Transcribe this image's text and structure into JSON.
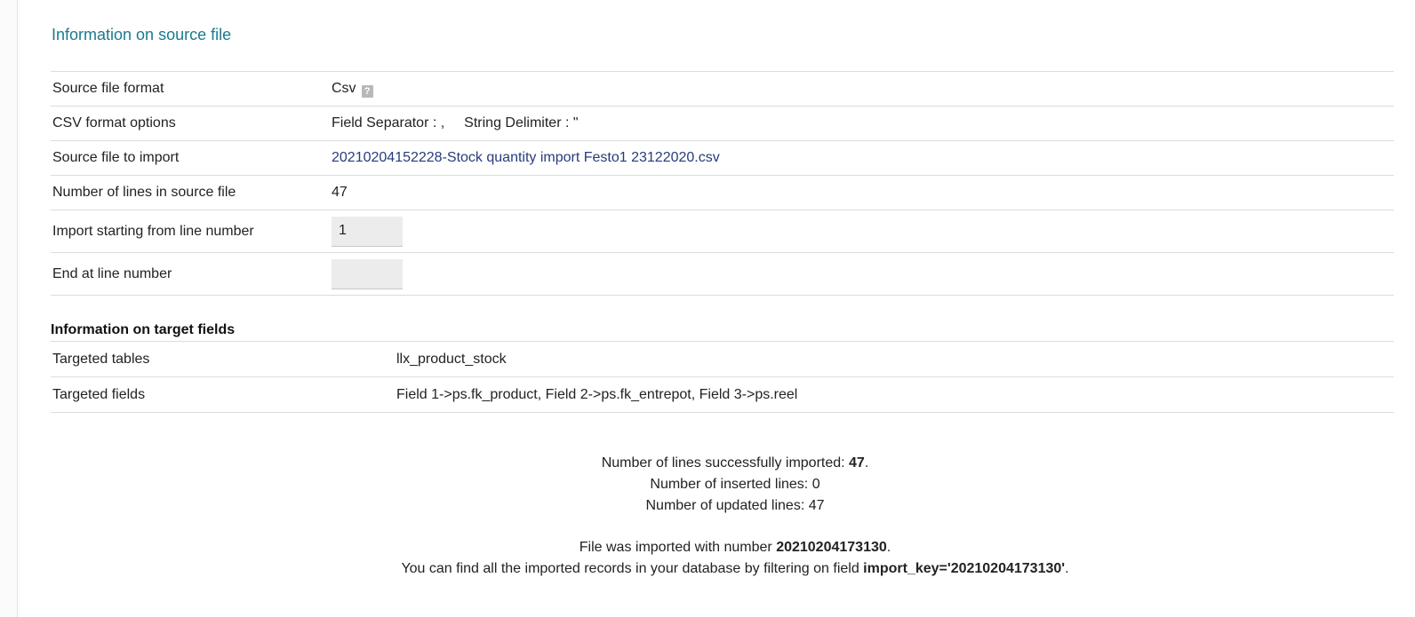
{
  "section_title": "Information on source file",
  "source_info": {
    "format_label": "Source file format",
    "format_value": "Csv",
    "help_icon": "question-mark",
    "csv_options_label": "CSV format options",
    "field_separator": "Field Separator : ,",
    "string_delimiter": "String Delimiter : \"",
    "file_label": "Source file to import",
    "file_name": "20210204152228-Stock quantity import Festo1 23122020.csv",
    "lines_label": "Number of lines in source file",
    "lines_value": "47",
    "start_label": "Import starting from line number",
    "start_value": "1",
    "end_label": "End at line number",
    "end_value": ""
  },
  "target": {
    "title": "Information on target fields",
    "tables_label": "Targeted tables",
    "tables_value": "llx_product_stock",
    "fields_label": "Targeted fields",
    "fields_value": "Field 1->ps.fk_product, Field 2->ps.fk_entrepot, Field 3->ps.reel"
  },
  "result": {
    "success_prefix": "Number of lines successfully imported: ",
    "success_count": "47",
    "success_suffix": ".",
    "inserted": "Number of inserted lines: 0",
    "updated": "Number of updated lines: 47",
    "imported_prefix": "File was imported with number ",
    "import_number": "20210204173130",
    "imported_suffix": ".",
    "filter_prefix": "You can find all the imported records in your database by filtering on field ",
    "filter_key": "import_key='20210204173130'",
    "filter_suffix": "."
  },
  "colors": {
    "title": "#1c7a8e",
    "link": "#263c7c",
    "input_bg": "#ececec",
    "row_border": "#dcdcdc"
  }
}
